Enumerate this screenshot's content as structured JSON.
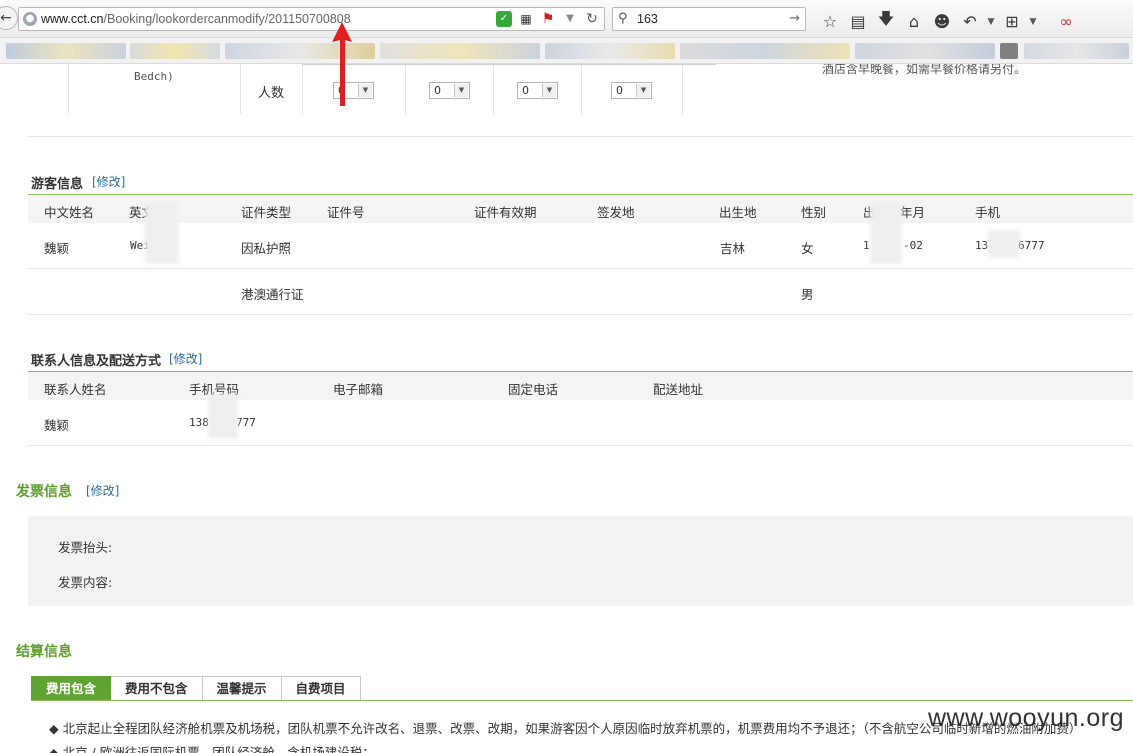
{
  "browser": {
    "url_host": "www.cct.cn",
    "url_path": "/Booking/lookordercanmodify/201150700808",
    "search_value": "163"
  },
  "hotel_section": {
    "room_type_text_partial": "Bedch)",
    "people_label": "人数",
    "selects": [
      "0",
      "0",
      "0",
      "0"
    ],
    "note_partial": "酒店含早晚餐，如需早餐价格请另付。"
  },
  "tourist_section": {
    "title": "游客信息",
    "edit": "[修改]",
    "headers": [
      "中文姓名",
      "英文",
      "证件类型",
      "证件号",
      "证件有效期",
      "签发地",
      "出生地",
      "性别",
      "出",
      "年月",
      "手机"
    ],
    "rows": [
      {
        "cn_name": "魏颖",
        "en_name": "Wei",
        "id_type": "因私护照",
        "id_no": "",
        "id_valid": "",
        "issue_place": "",
        "birth_place": "吉林",
        "gender": "女",
        "birth_a": "1",
        "birth_b": "-02",
        "phone_a": "13",
        "phone_b": "6777"
      },
      {
        "cn_name": "",
        "en_name": "",
        "id_type": "港澳通行证",
        "id_no": "",
        "id_valid": "",
        "issue_place": "",
        "birth_place": "",
        "gender": "男",
        "birth_a": "",
        "birth_b": "",
        "phone_a": "",
        "phone_b": ""
      }
    ]
  },
  "contact_section": {
    "title": "联系人信息及配送方式",
    "edit": "[修改]",
    "headers": [
      "联系人姓名",
      "手机号码",
      "电子邮箱",
      "固定电话",
      "配送地址"
    ],
    "row": {
      "name": "魏颖",
      "phone_a": "138",
      "phone_b": "777",
      "email": "",
      "tel": "",
      "address": ""
    }
  },
  "invoice_section": {
    "title": "发票信息",
    "edit": "[修改]",
    "header_label": "发票抬头:",
    "content_label": "发票内容:"
  },
  "settlement_section": {
    "title": "结算信息",
    "tabs": [
      "费用包含",
      "费用不包含",
      "温馨提示",
      "自费项目"
    ],
    "active_tab": 0,
    "items": [
      "◆ 北京起止全程团队经济舱机票及机场税，团队机票不允许改名、退票、改票、改期，如果游客因个人原因临时放弃机票的，机票费用均不予退还；（不含航空公司临时新增的燃油附加费）",
      "◆ 北京 / 欧洲往返国际机票，团队经济舱，含机场建设税；"
    ]
  },
  "watermark": "www.wooyun.org",
  "colors": {
    "accent_green": "#5fa433",
    "link_blue": "#2a6ca0",
    "arrow_red": "#e02020"
  }
}
